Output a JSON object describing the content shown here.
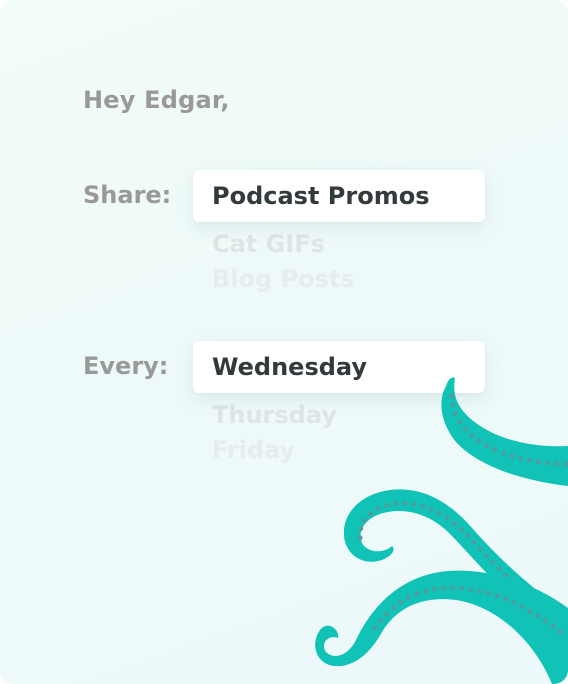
{
  "greeting": "Hey Edgar,",
  "share": {
    "label": "Share:",
    "selected": "Podcast Promos",
    "options": [
      "Cat GIFs",
      "Blog Posts"
    ]
  },
  "every": {
    "label": "Every:",
    "selected": "Wednesday",
    "options": [
      "Thursday",
      "Friday"
    ]
  },
  "colors": {
    "tentacle": "#11c3b6",
    "sucker": "#4b9fa1",
    "label": "#999999",
    "selected_text": "#333a3c"
  }
}
